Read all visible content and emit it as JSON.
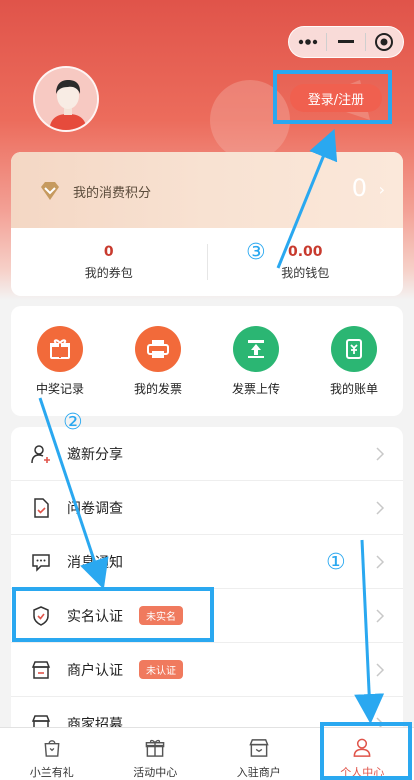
{
  "header": {
    "login_label": "登录/注册"
  },
  "points": {
    "label": "我的消费积分",
    "value": "0",
    "coupon_value": "0",
    "coupon_label": "我的券包",
    "wallet_value": "0.00",
    "wallet_label": "我的钱包"
  },
  "quick_actions": [
    {
      "label": "中奖记录",
      "icon": "gift-icon",
      "color": "#f26a3a"
    },
    {
      "label": "我的发票",
      "icon": "printer-icon",
      "color": "#f26a3a"
    },
    {
      "label": "发票上传",
      "icon": "upload-icon",
      "color": "#2bb673"
    },
    {
      "label": "我的账单",
      "icon": "bill-icon",
      "color": "#2bb673"
    }
  ],
  "menu": [
    {
      "label": "邀新分享",
      "icon": "user-plus-icon"
    },
    {
      "label": "问卷调查",
      "icon": "document-check-icon"
    },
    {
      "label": "消息通知",
      "icon": "message-icon"
    },
    {
      "label": "实名认证",
      "icon": "shield-icon",
      "badge": "未实名"
    },
    {
      "label": "商户认证",
      "icon": "store-icon",
      "badge": "未认证"
    },
    {
      "label": "商家招募",
      "icon": "storefront-icon"
    }
  ],
  "tabs": [
    {
      "label": "小兰有礼",
      "icon": "bag-icon"
    },
    {
      "label": "活动中心",
      "icon": "gift-box-icon"
    },
    {
      "label": "入驻商户",
      "icon": "shop-icon"
    },
    {
      "label": "个人中心",
      "icon": "person-icon",
      "active": true
    }
  ],
  "annotations": {
    "one": "①",
    "two": "②",
    "three": "③"
  },
  "colors": {
    "brand": "#e0544a",
    "annotation": "#2aa8f0"
  }
}
